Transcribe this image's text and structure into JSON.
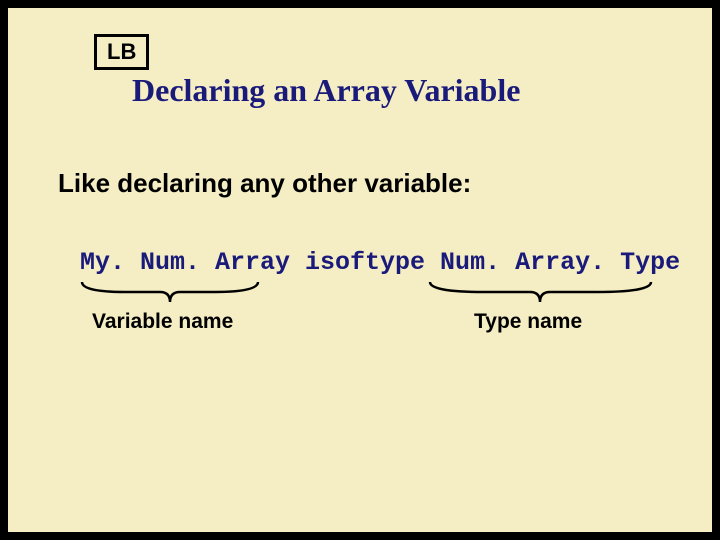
{
  "badge": "LB",
  "title": "Declaring an Array Variable",
  "subtitle": "Like declaring any other variable:",
  "code": "My. Num. Array isoftype Num. Array. Type",
  "annotations": {
    "variable_name": "Variable name",
    "type_name": "Type name"
  }
}
